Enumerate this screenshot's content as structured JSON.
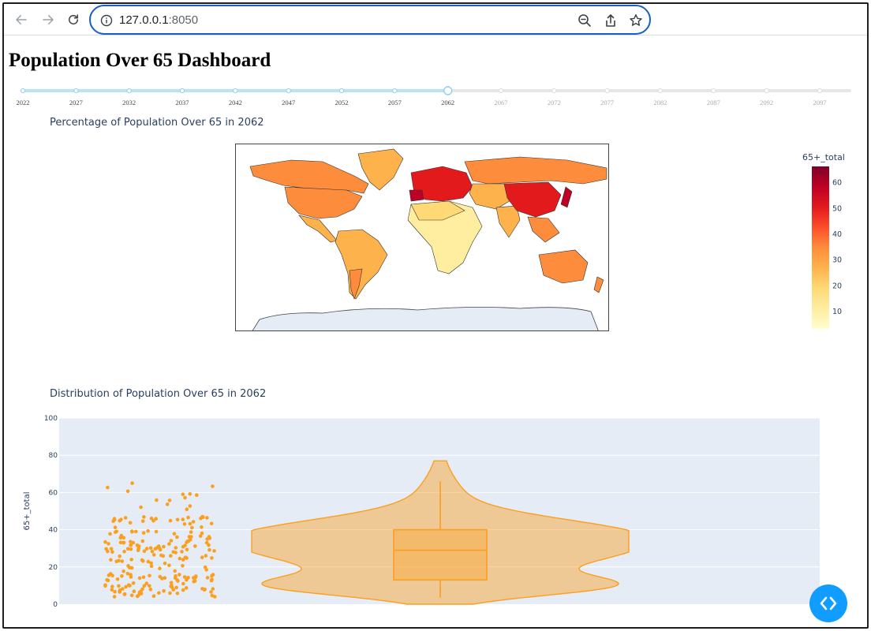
{
  "browser": {
    "url_host": "127.0.0.1",
    "url_port": ":8050",
    "icons": [
      "back-icon",
      "forward-icon",
      "reload-icon",
      "info-icon",
      "zoom-out-icon",
      "share-icon",
      "bookmark-star-icon"
    ]
  },
  "page": {
    "title": "Population Over 65 Dashboard"
  },
  "slider": {
    "marks": [
      "2022",
      "2027",
      "2032",
      "2037",
      "2042",
      "2047",
      "2052",
      "2057",
      "2062",
      "2067",
      "2072",
      "2077",
      "2082",
      "2087",
      "2092",
      "2097"
    ],
    "selected": "2062",
    "active_color": "#b9e3f7",
    "inactive_color": "#e6e6e6"
  },
  "map": {
    "title": "Percentage of Population Over 65 in 2062",
    "colorbar_title": "65+_total",
    "colorbar_ticks": [
      "10",
      "20",
      "30",
      "40",
      "50",
      "60"
    ],
    "colorscale": [
      "#ffffcc",
      "#ffeda0",
      "#fed976",
      "#feb24c",
      "#fd8d3c",
      "#fc4e2a",
      "#e31a1c",
      "#bd0026",
      "#800026"
    ]
  },
  "chart_data": {
    "type": "violin",
    "title": "Distribution of Population Over 65 in 2062",
    "ylabel": "65+_total",
    "ylim": [
      0,
      100
    ],
    "yticks": [
      0,
      20,
      40,
      60,
      80,
      100
    ],
    "series_color": "#fb9f1f",
    "box": {
      "min": 3.5,
      "q1": 13,
      "median": 29,
      "q3": 40,
      "max": 66
    },
    "violin_extent": [
      0,
      77
    ],
    "points_approx_range": [
      3,
      66
    ]
  },
  "controls": {
    "code_toggle_icon": "code-toggle-icon"
  }
}
